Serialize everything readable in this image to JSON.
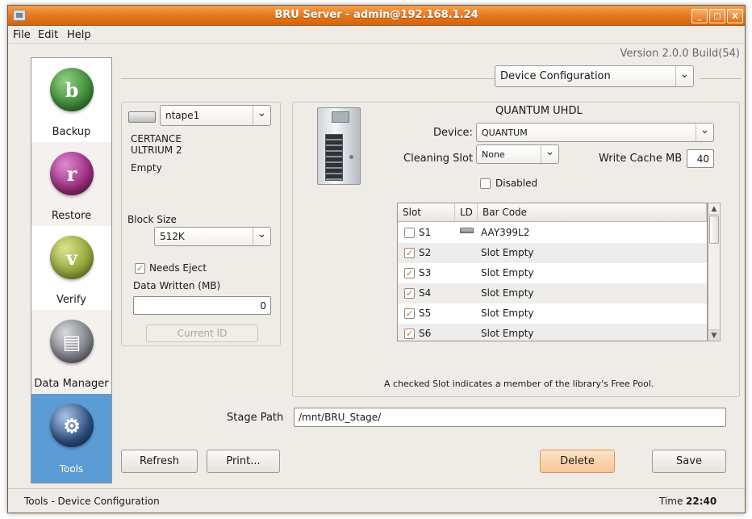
{
  "window": {
    "title": "BRU Server - admin@192.168.1.24",
    "buttons": [
      "_",
      "□",
      "X"
    ]
  },
  "menu": [
    "File",
    "Edit",
    "Help"
  ],
  "version": "Version 2.0.0 Build(54)",
  "sidebar": {
    "items": [
      {
        "label": "Backup",
        "icon": "backup-icon",
        "glyph": "b",
        "color": "#3e8a3a",
        "active": false
      },
      {
        "label": "Restore",
        "icon": "restore-icon",
        "glyph": "r",
        "color": "#9a2c7c",
        "active": false
      },
      {
        "label": "Verify",
        "icon": "verify-icon",
        "glyph": "v",
        "color": "#93a43b",
        "active": false
      },
      {
        "label": "Data Manager",
        "icon": "data-manager-icon",
        "glyph": "▤",
        "color": "#7c7f84",
        "active": false
      },
      {
        "label": "Tools",
        "icon": "tools-icon",
        "glyph": "⚙",
        "color": "#2e4f80",
        "active": true
      }
    ]
  },
  "section_select": {
    "value": "Device Configuration"
  },
  "drive_panel": {
    "drive_select": "ntape1",
    "model_line1": "CERTANCE",
    "model_line2": "ULTRIUM 2",
    "status": "Empty",
    "block_size_label": "Block Size",
    "block_size_value": "512K",
    "needs_eject_label": "Needs Eject",
    "needs_eject_checked": true,
    "data_written_label": "Data Written (MB)",
    "data_written_value": "0",
    "current_id_label": "Current ID"
  },
  "library_panel": {
    "title": "QUANTUM UHDL",
    "device_label": "Device:",
    "device_value": "QUANTUM",
    "cleaning_slot_label": "Cleaning Slot",
    "cleaning_slot_value": "None",
    "write_cache_label": "Write Cache MB",
    "write_cache_value": "40",
    "disabled_label": "Disabled",
    "disabled_checked": false,
    "table": {
      "headers": [
        "Slot",
        "LD",
        "Bar Code"
      ],
      "rows": [
        {
          "slot": "S1",
          "checked": false,
          "ld": true,
          "barcode": "AAY399L2"
        },
        {
          "slot": "S2",
          "checked": true,
          "ld": false,
          "barcode": "Slot Empty"
        },
        {
          "slot": "S3",
          "checked": true,
          "ld": false,
          "barcode": "Slot Empty"
        },
        {
          "slot": "S4",
          "checked": true,
          "ld": false,
          "barcode": "Slot Empty"
        },
        {
          "slot": "S5",
          "checked": true,
          "ld": false,
          "barcode": "Slot Empty"
        },
        {
          "slot": "S6",
          "checked": true,
          "ld": false,
          "barcode": "Slot Empty"
        }
      ]
    },
    "note": "A checked Slot indicates a member of the library's Free Pool."
  },
  "stage_path": {
    "label": "Stage Path",
    "value": "/mnt/BRU_Stage/"
  },
  "buttons": {
    "refresh": "Refresh",
    "print": "Print...",
    "delete": "Delete",
    "save": "Save"
  },
  "status": {
    "left": "Tools - Device Configuration",
    "time_label": "Time",
    "time_value": "22:40"
  }
}
